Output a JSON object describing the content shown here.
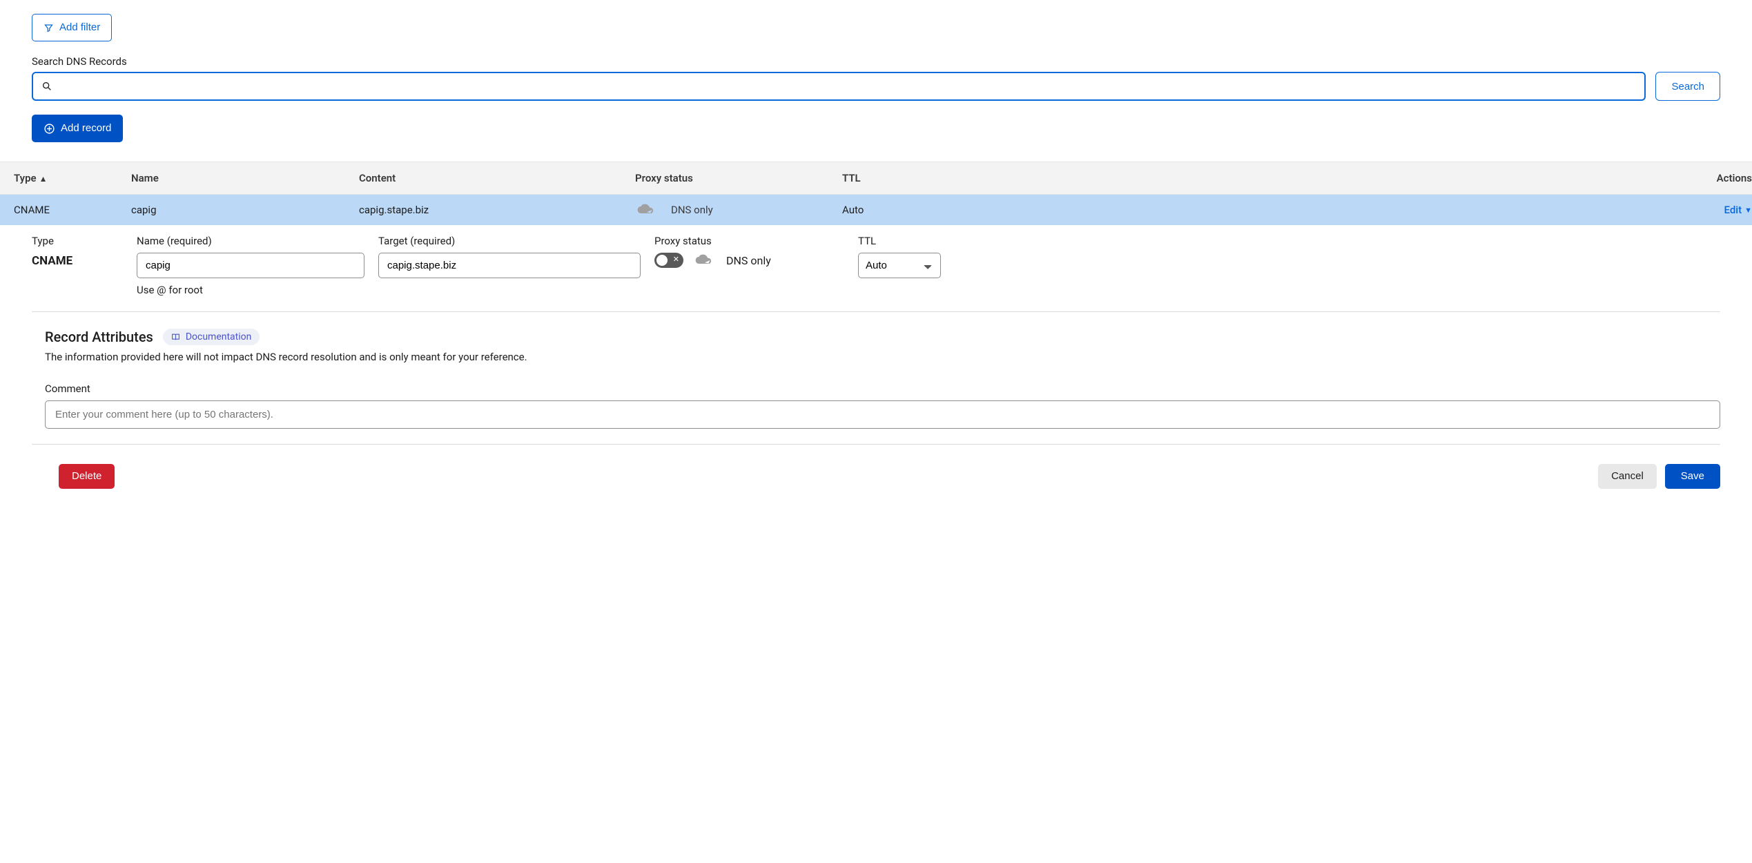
{
  "filter": {
    "add_filter_label": "Add filter"
  },
  "search": {
    "label": "Search DNS Records",
    "button": "Search",
    "value": ""
  },
  "add_record_label": "Add record",
  "table": {
    "headers": {
      "type": "Type",
      "name": "Name",
      "content": "Content",
      "proxy": "Proxy status",
      "ttl": "TTL",
      "actions": "Actions"
    },
    "row": {
      "type": "CNAME",
      "name": "capig",
      "content": "capig.stape.biz",
      "proxy": "DNS only",
      "ttl": "Auto",
      "edit": "Edit"
    }
  },
  "edit": {
    "type_label": "Type",
    "type_value": "CNAME",
    "name_label": "Name (required)",
    "name_value": "capig",
    "name_help": "Use @ for root",
    "target_label": "Target (required)",
    "target_value": "capig.stape.biz",
    "proxy_label": "Proxy status",
    "proxy_text": "DNS only",
    "ttl_label": "TTL",
    "ttl_value": "Auto"
  },
  "attrs": {
    "title": "Record Attributes",
    "doc": "Documentation",
    "desc": "The information provided here will not impact DNS record resolution and is only meant for your reference.",
    "comment_label": "Comment",
    "comment_placeholder": "Enter your comment here (up to 50 characters)."
  },
  "footer": {
    "delete": "Delete",
    "cancel": "Cancel",
    "save": "Save"
  }
}
